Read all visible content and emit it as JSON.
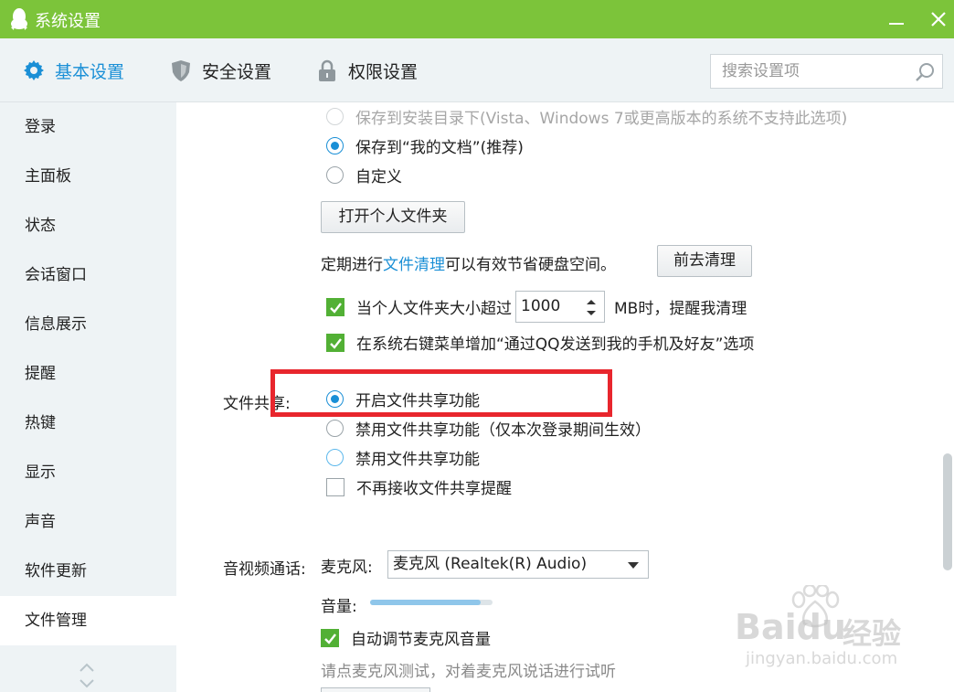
{
  "window": {
    "title": "系统设置"
  },
  "tabs": [
    {
      "label": "基本设置",
      "icon": "gear-icon"
    },
    {
      "label": "安全设置",
      "icon": "shield-icon"
    },
    {
      "label": "权限设置",
      "icon": "lock-icon"
    }
  ],
  "search": {
    "placeholder": "搜索设置项",
    "value": ""
  },
  "sidebar": {
    "items": [
      {
        "label": "登录"
      },
      {
        "label": "主面板"
      },
      {
        "label": "状态"
      },
      {
        "label": "会话窗口"
      },
      {
        "label": "信息展示"
      },
      {
        "label": "提醒"
      },
      {
        "label": "热键"
      },
      {
        "label": "显示"
      },
      {
        "label": "声音"
      },
      {
        "label": "软件更新"
      },
      {
        "label": "文件管理"
      }
    ],
    "active": "文件管理"
  },
  "file_management": {
    "save_options": [
      {
        "label": "保存到安装目录下(Vista、Windows 7或更高版本的系统不支持此选项)",
        "state": "disabled"
      },
      {
        "label": "保存到“我的文档”(推荐)",
        "state": "checked"
      },
      {
        "label": "自定义",
        "state": "unchecked"
      }
    ],
    "open_folder_button": "打开个人文件夹",
    "cleanup": {
      "prefix": "定期进行",
      "link": "文件清理",
      "suffix": "可以有效节省硬盘空间。",
      "button": "前去清理"
    },
    "size_limit": {
      "prefix": "当个人文件夹大小超过",
      "value": "1000",
      "suffix": "MB时，提醒我清理",
      "checked": true
    },
    "context_menu": {
      "label": "在系统右键菜单增加“通过QQ发送到我的手机及好友”选项",
      "checked": true
    }
  },
  "file_sharing": {
    "label": "文件共享:",
    "options": [
      {
        "label": "开启文件共享功能",
        "state": "checked"
      },
      {
        "label": "禁用文件共享功能（仅本次登录期间生效）",
        "state": "unchecked"
      },
      {
        "label": "禁用文件共享功能",
        "state": "hover"
      }
    ],
    "no_reminder": {
      "label": "不再接收文件共享提醒",
      "checked": false
    }
  },
  "av_call": {
    "label": "音视频通话:",
    "mic_label": "麦克风:",
    "mic_value": "麦克风 (Realtek(R) Audio)",
    "volume_label": "音量:",
    "volume_level": 0.9,
    "auto_adjust": {
      "label": "自动调节麦克风音量",
      "checked": true
    },
    "hint": "请点麦克风测试，对着麦克风说话进行试听"
  },
  "watermark": {
    "brand": "Baidu",
    "sub": "经验",
    "url": "jingyan.baidu.com"
  },
  "colors": {
    "titlebar": "#7cc43a",
    "accent": "#1a8fd6",
    "checkbox_green": "#52b035",
    "highlight_red": "#e8262d"
  }
}
